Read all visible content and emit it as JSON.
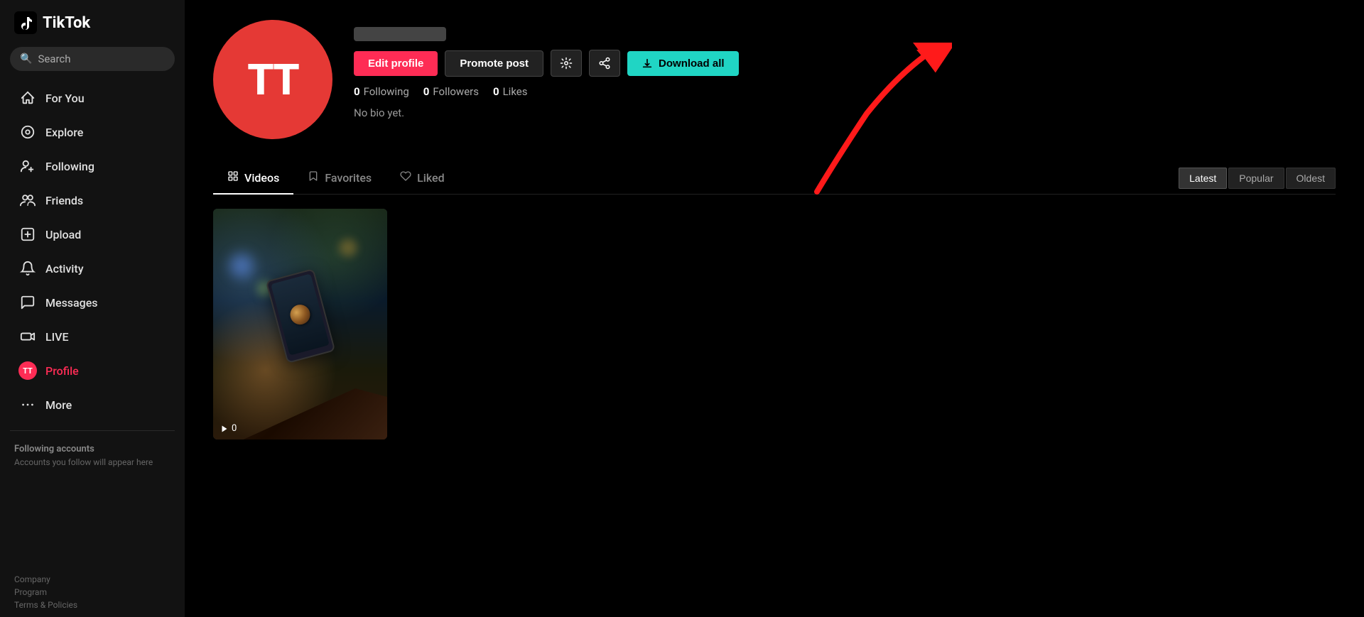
{
  "app": {
    "logo_text": "TikTok",
    "tiktok_symbol": "♪"
  },
  "sidebar": {
    "search_placeholder": "Search",
    "nav_items": [
      {
        "id": "for-you",
        "label": "For You",
        "icon": "⌂",
        "active": false
      },
      {
        "id": "explore",
        "label": "Explore",
        "icon": "◎",
        "active": false
      },
      {
        "id": "following",
        "label": "Following",
        "icon": "👤+",
        "active": false
      },
      {
        "id": "friends",
        "label": "Friends",
        "icon": "👥",
        "active": false
      },
      {
        "id": "upload",
        "label": "Upload",
        "icon": "➕",
        "active": false
      },
      {
        "id": "activity",
        "label": "Activity",
        "icon": "🔔",
        "active": false
      },
      {
        "id": "messages",
        "label": "Messages",
        "icon": "✉",
        "active": false
      },
      {
        "id": "live",
        "label": "LIVE",
        "icon": "📺",
        "active": false
      },
      {
        "id": "profile",
        "label": "Profile",
        "icon": "TT",
        "active": true
      },
      {
        "id": "more",
        "label": "More",
        "icon": "···",
        "active": false
      }
    ],
    "following_section": {
      "title": "Following accounts",
      "subtitle": "Accounts you follow will appear here"
    },
    "footer_links": [
      "Company",
      "Program",
      "Terms & Policies"
    ]
  },
  "profile": {
    "username_placeholder": "████████ ████",
    "avatar_letters": "TT",
    "actions": {
      "edit_profile": "Edit profile",
      "promote_post": "Promote post",
      "download_all": "Download all"
    },
    "stats": {
      "following_count": "0",
      "following_label": "Following",
      "followers_count": "0",
      "followers_label": "Followers",
      "likes_count": "0",
      "likes_label": "Likes"
    },
    "bio": "No bio yet."
  },
  "tabs": [
    {
      "id": "videos",
      "label": "Videos",
      "icon": "▦",
      "active": true
    },
    {
      "id": "favorites",
      "label": "Favorites",
      "icon": "🔖",
      "active": false
    },
    {
      "id": "liked",
      "label": "Liked",
      "icon": "♡",
      "active": false
    }
  ],
  "sort_options": [
    {
      "id": "latest",
      "label": "Latest",
      "active": true
    },
    {
      "id": "popular",
      "label": "Popular",
      "active": false
    },
    {
      "id": "oldest",
      "label": "Oldest",
      "active": false
    }
  ],
  "videos": [
    {
      "id": "v1",
      "play_count": "0"
    }
  ],
  "colors": {
    "accent_red": "#fe2c55",
    "accent_teal": "#20d5c4",
    "sidebar_bg": "#121212",
    "main_bg": "#000000"
  }
}
